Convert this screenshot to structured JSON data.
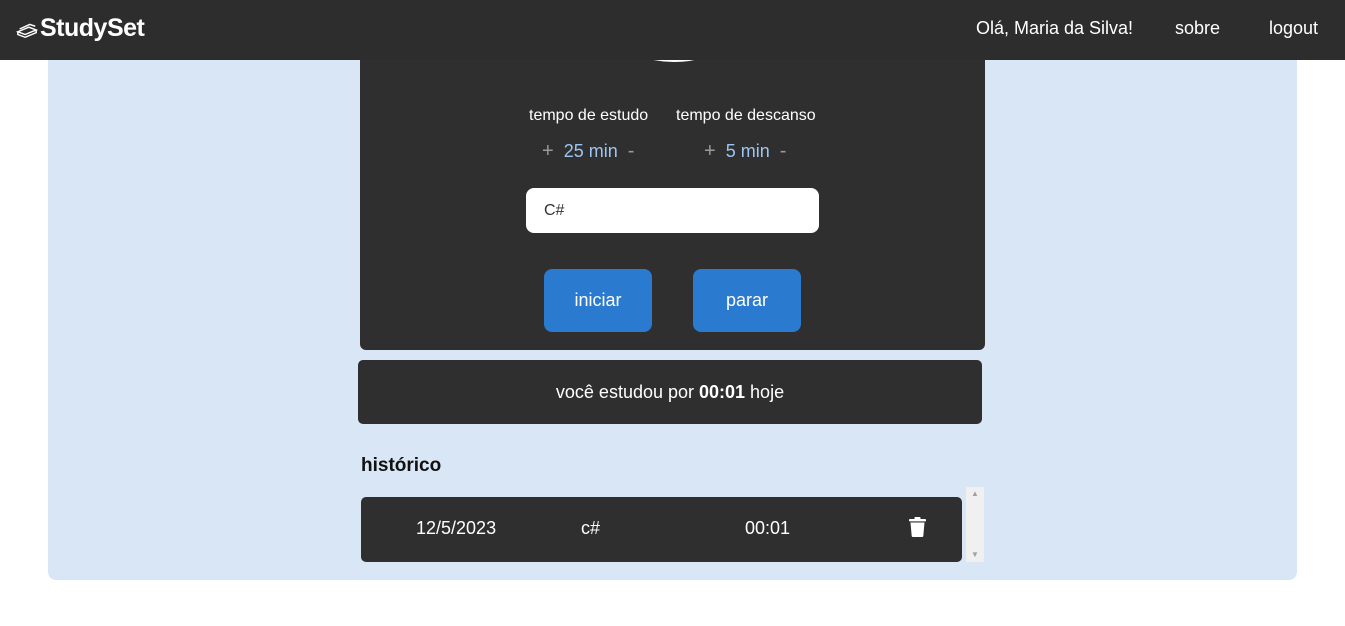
{
  "nav": {
    "brand": "StudySet",
    "greeting": "Olá, Maria da Silva!",
    "about": "sobre",
    "logout": "logout"
  },
  "timer": {
    "study_label": "tempo de estudo",
    "rest_label": "tempo de descanso",
    "study_value": "25 min",
    "rest_value": "5 min",
    "plus": "+",
    "minus": "-",
    "subject_value": "C#",
    "start_label": "iniciar",
    "stop_label": "parar"
  },
  "summary": {
    "prefix": "você estudou por",
    "time": "00:01",
    "suffix": "hoje"
  },
  "history": {
    "title": "histórico",
    "rows": [
      {
        "date": "12/5/2023",
        "subject": "c#",
        "duration": "00:01"
      }
    ]
  },
  "colors": {
    "navbar": "#2d2d2d",
    "panel": "#d8e6f6",
    "card": "#2f2f2f",
    "button": "#2a7acf",
    "accent_value": "#9cc5f2"
  },
  "icons": {
    "brand": "books-icon",
    "delete": "trash-icon"
  }
}
